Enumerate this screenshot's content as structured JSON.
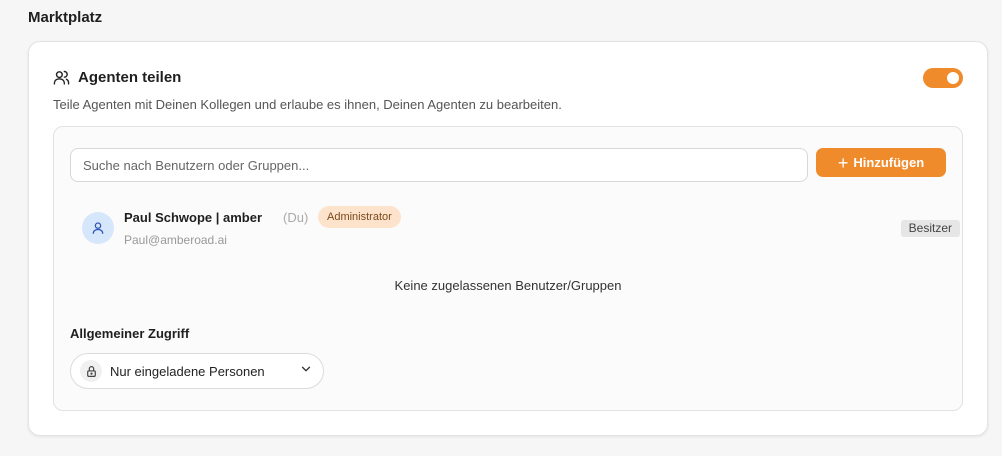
{
  "section": {
    "title": "Marktplatz"
  },
  "card": {
    "title": "Agenten teilen",
    "description": "Teile Agenten mit Deinen Kollegen und erlaube es ihnen, Deinen Agenten zu bearbeiten.",
    "toggle_on": true
  },
  "search": {
    "placeholder": "Suche nach Benutzern oder Gruppen..."
  },
  "add_button": {
    "icon": "plus-icon",
    "label": "Hinzufügen"
  },
  "user": {
    "name": "Paul Schwope | amber",
    "you_label": "(Du)",
    "role": "Administrator",
    "email": "Paul@amberoad.ai",
    "owner_badge": "Besitzer"
  },
  "empty_message": "Keine zugelassenen Benutzer/Gruppen",
  "access": {
    "title": "Allgemeiner Zugriff",
    "selected": "Nur eingeladene Personen"
  },
  "colors": {
    "accent": "#f08b2c",
    "badge_bg": "#fde3cc",
    "avatar_bg": "#d6e6fb"
  }
}
